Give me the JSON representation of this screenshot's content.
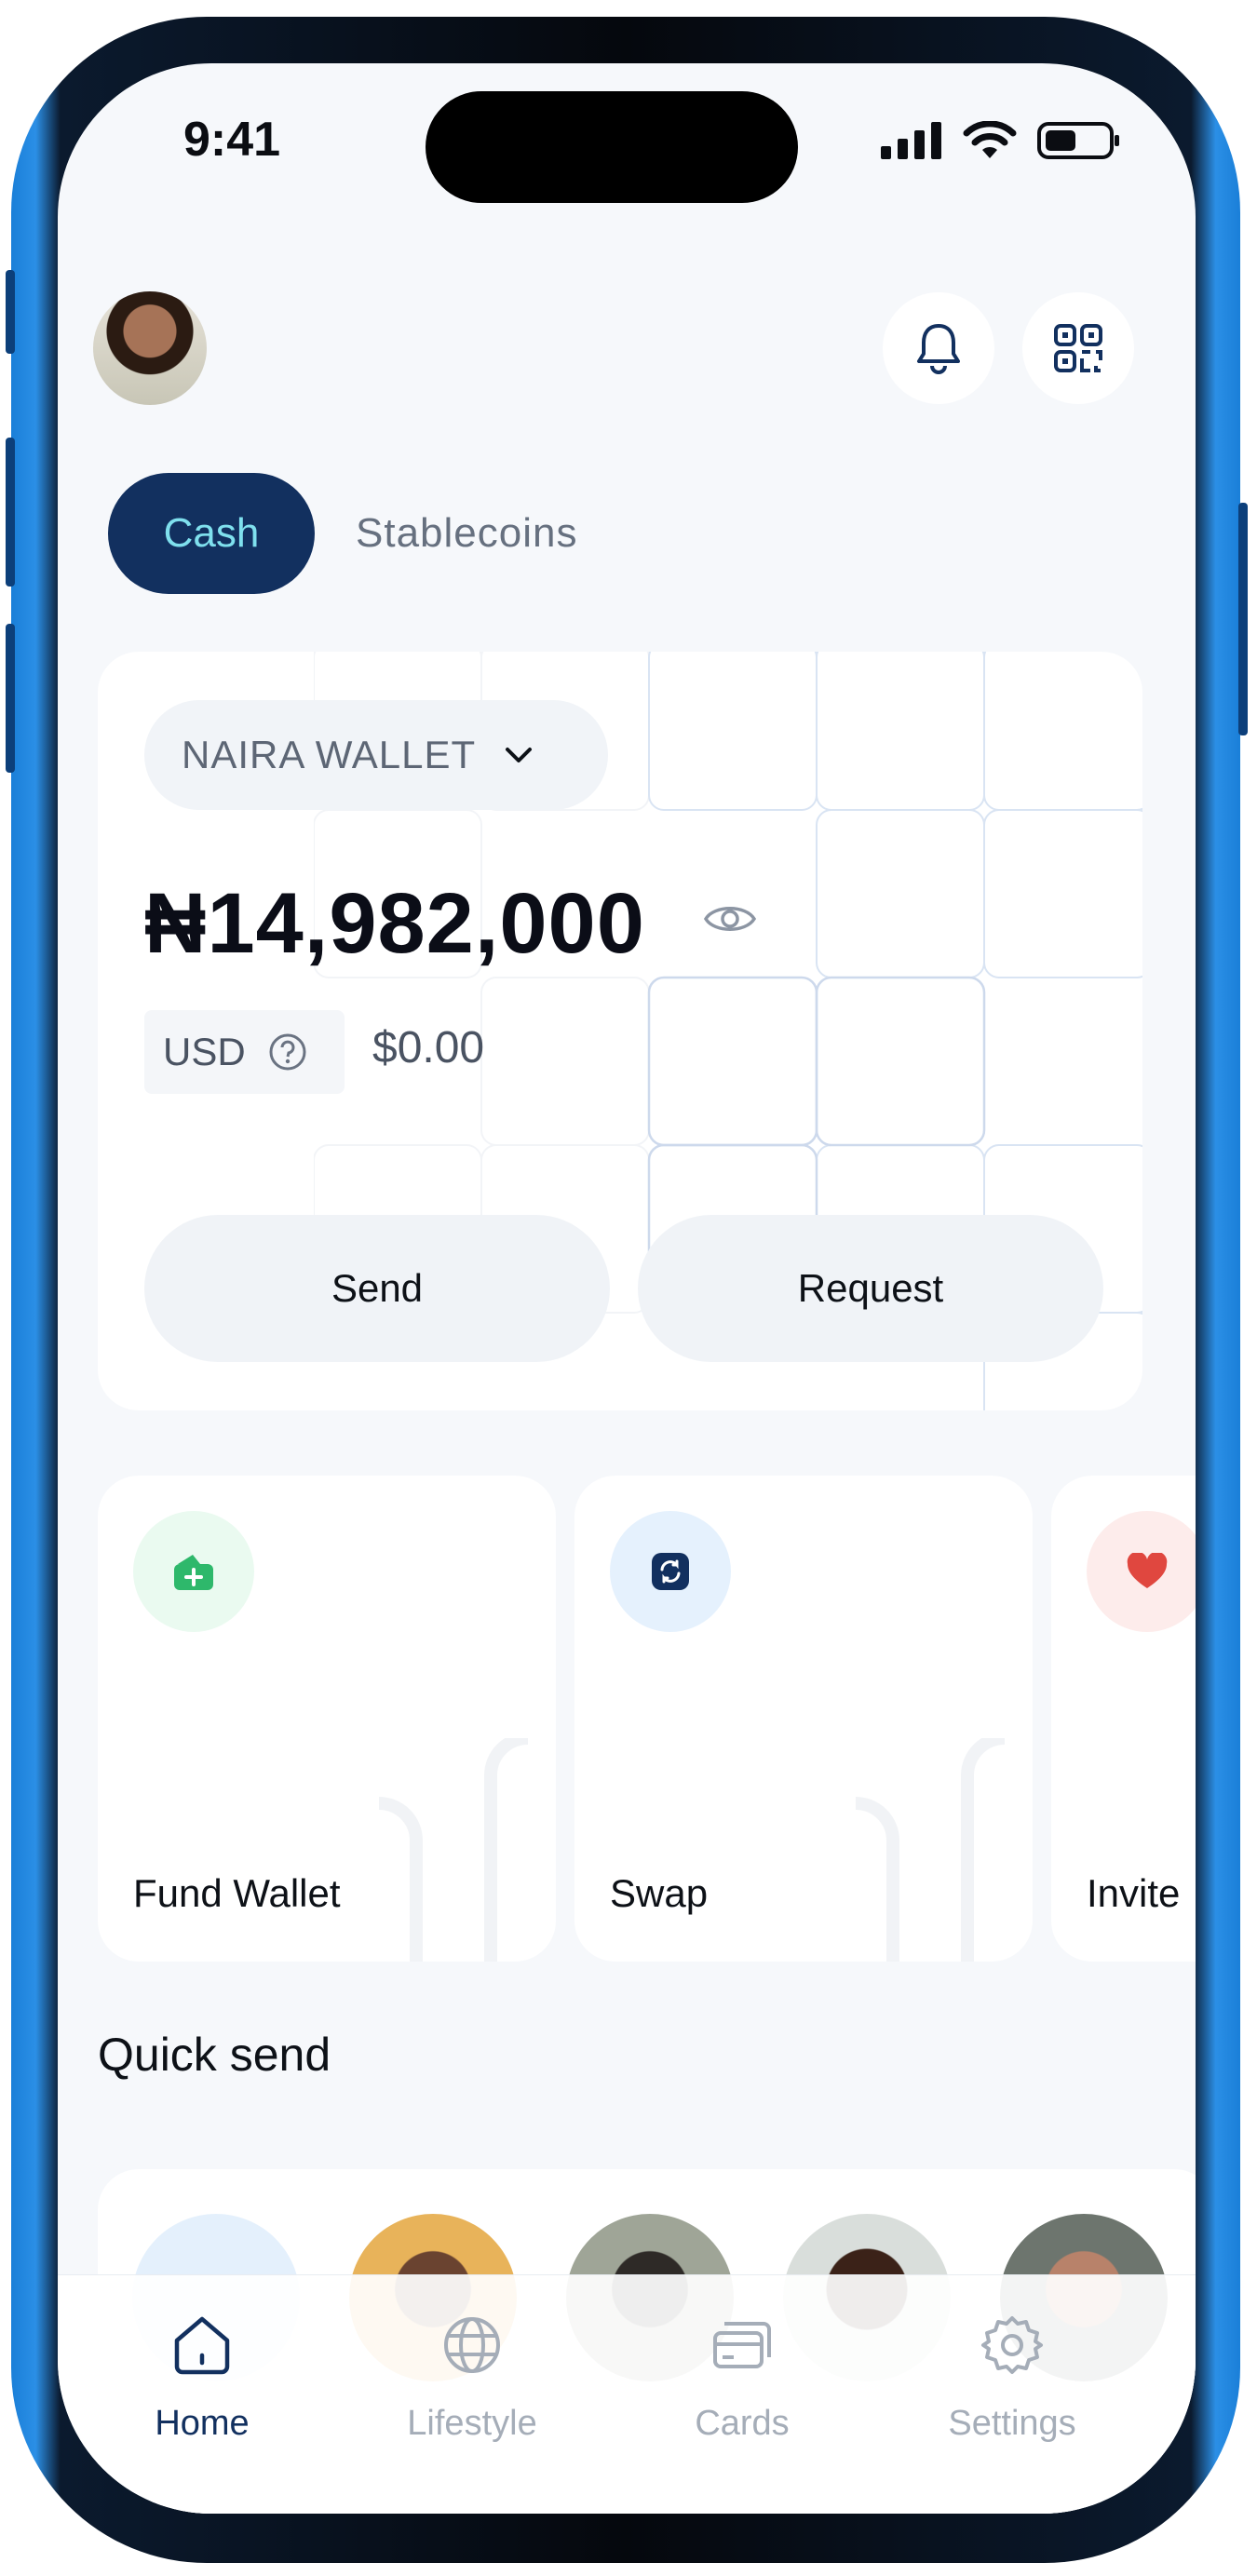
{
  "status_bar": {
    "time": "9:41"
  },
  "header": {
    "avatar": "user-avatar",
    "icons": [
      "bell-icon",
      "qr-code-icon"
    ]
  },
  "tabs": [
    {
      "label": "Cash",
      "active": true
    },
    {
      "label": "Stablecoins",
      "active": false
    }
  ],
  "wallet": {
    "selector_label": "NAIRA WALLET",
    "balance": "₦14,982,000",
    "currency_label": "USD",
    "usd_value": "$0.00",
    "send_label": "Send",
    "request_label": "Request"
  },
  "actions": [
    {
      "label": "Fund Wallet",
      "icon": "wallet-plus-icon",
      "color": "#2eb86b"
    },
    {
      "label": "Swap",
      "icon": "swap-icon",
      "color": "#12305f"
    },
    {
      "label": "Invite",
      "icon": "heart-icon",
      "color": "#e0473f"
    }
  ],
  "quick_send": {
    "title": "Quick send"
  },
  "nav": [
    {
      "label": "Home",
      "icon": "home-icon",
      "active": true
    },
    {
      "label": "Lifestyle",
      "icon": "globe-icon",
      "active": false
    },
    {
      "label": "Cards",
      "icon": "cards-icon",
      "active": false
    },
    {
      "label": "Settings",
      "icon": "gear-icon",
      "active": false
    }
  ],
  "colors": {
    "primary": "#12305f",
    "accent": "#7fe0ee",
    "frame": "#1a7fd8"
  }
}
